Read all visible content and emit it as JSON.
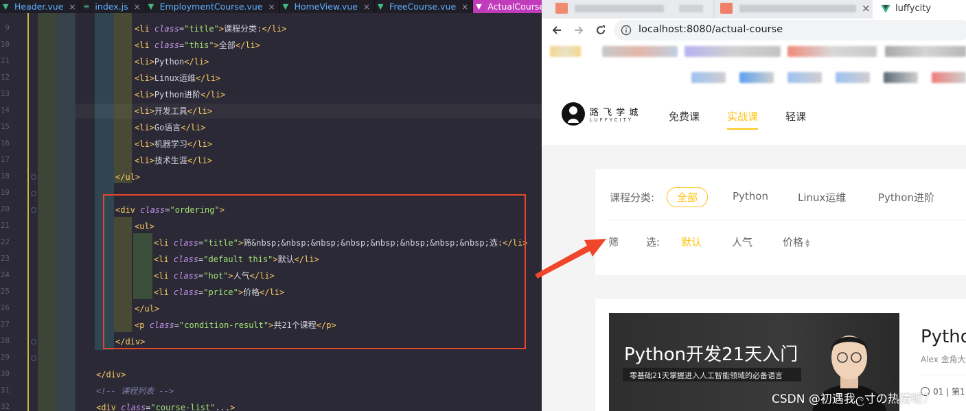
{
  "editor": {
    "tabs": [
      {
        "label": "Header.vue",
        "icon": "vue-icon",
        "active": false
      },
      {
        "label": "index.js",
        "icon": "js-file-icon",
        "active": false
      },
      {
        "label": "EmploymentCourse.vue",
        "icon": "vue-icon",
        "active": false
      },
      {
        "label": "HomeView.vue",
        "icon": "vue-icon",
        "active": false
      },
      {
        "label": "FreeCourse.vue",
        "icon": "vue-icon",
        "active": false
      },
      {
        "label": "ActualCourse.vue",
        "icon": "vue-icon",
        "active": true
      }
    ],
    "close_glyph": "×",
    "line_numbers": [
      "9",
      "10",
      "11",
      "12",
      "13",
      "14",
      "15",
      "16",
      "17",
      "18",
      "19",
      "20",
      "21",
      "22",
      "23",
      "24",
      "25",
      "26",
      "27",
      "28",
      "29",
      "30",
      "31",
      "32"
    ],
    "code_lines": [
      {
        "indent": 196,
        "parts": [
          [
            "tg",
            "<li "
          ],
          [
            "at",
            "class"
          ],
          [
            "tx",
            "="
          ],
          [
            "st",
            "\"title\""
          ],
          [
            "tg",
            ">"
          ],
          [
            "tx",
            "课程分类:"
          ],
          [
            "tg",
            "</li>"
          ]
        ]
      },
      {
        "indent": 196,
        "parts": [
          [
            "tg",
            "<li "
          ],
          [
            "at",
            "class"
          ],
          [
            "tx",
            "="
          ],
          [
            "st",
            "\"this\""
          ],
          [
            "tg",
            ">"
          ],
          [
            "tx",
            "全部"
          ],
          [
            "tg",
            "</li>"
          ]
        ]
      },
      {
        "indent": 196,
        "parts": [
          [
            "tg",
            "<li>"
          ],
          [
            "tx",
            "Python"
          ],
          [
            "tg",
            "</li>"
          ]
        ]
      },
      {
        "indent": 196,
        "parts": [
          [
            "tg",
            "<li>"
          ],
          [
            "tx",
            "Linux运维"
          ],
          [
            "tg",
            "</li>"
          ]
        ]
      },
      {
        "indent": 196,
        "parts": [
          [
            "tg",
            "<li>"
          ],
          [
            "tx",
            "Python进阶"
          ],
          [
            "tg",
            "</li>"
          ]
        ]
      },
      {
        "indent": 196,
        "parts": [
          [
            "tg",
            "<li>"
          ],
          [
            "tx",
            "开发工具"
          ],
          [
            "tg",
            "</li>"
          ]
        ]
      },
      {
        "indent": 196,
        "parts": [
          [
            "tg",
            "<li>"
          ],
          [
            "tx",
            "Go语言"
          ],
          [
            "tg",
            "</li>"
          ]
        ]
      },
      {
        "indent": 196,
        "parts": [
          [
            "tg",
            "<li>"
          ],
          [
            "tx",
            "机器学习"
          ],
          [
            "tg",
            "</li>"
          ]
        ]
      },
      {
        "indent": 196,
        "parts": [
          [
            "tg",
            "<li>"
          ],
          [
            "tx",
            "技术生涯"
          ],
          [
            "tg",
            "</li>"
          ]
        ]
      },
      {
        "indent": 168,
        "parts": [
          [
            "tg",
            "</ul>"
          ]
        ]
      },
      {
        "indent": 168,
        "parts": []
      },
      {
        "indent": 168,
        "parts": [
          [
            "tg",
            "<div "
          ],
          [
            "at",
            "class"
          ],
          [
            "tx",
            "="
          ],
          [
            "st",
            "\"ordering\""
          ],
          [
            "tg",
            ">"
          ]
        ]
      },
      {
        "indent": 196,
        "parts": [
          [
            "tg",
            "<ul>"
          ]
        ]
      },
      {
        "indent": 224,
        "parts": [
          [
            "tg",
            "<li "
          ],
          [
            "at",
            "class"
          ],
          [
            "tx",
            "="
          ],
          [
            "st",
            "\"title\""
          ],
          [
            "tg",
            ">"
          ],
          [
            "tx",
            "筛&nbsp;&nbsp;&nbsp;&nbsp;&nbsp;&nbsp;&nbsp;&nbsp;选:"
          ],
          [
            "tg",
            "</li>"
          ]
        ]
      },
      {
        "indent": 224,
        "parts": [
          [
            "tg",
            "<li "
          ],
          [
            "at",
            "class"
          ],
          [
            "tx",
            "="
          ],
          [
            "st",
            "\"default this\""
          ],
          [
            "tg",
            ">"
          ],
          [
            "tx",
            "默认"
          ],
          [
            "tg",
            "</li>"
          ]
        ]
      },
      {
        "indent": 224,
        "parts": [
          [
            "tg",
            "<li "
          ],
          [
            "at",
            "class"
          ],
          [
            "tx",
            "="
          ],
          [
            "st",
            "\"hot\""
          ],
          [
            "tg",
            ">"
          ],
          [
            "tx",
            "人气"
          ],
          [
            "tg",
            "</li>"
          ]
        ]
      },
      {
        "indent": 224,
        "parts": [
          [
            "tg",
            "<li "
          ],
          [
            "at",
            "class"
          ],
          [
            "tx",
            "="
          ],
          [
            "st",
            "\"price\""
          ],
          [
            "tg",
            ">"
          ],
          [
            "tx",
            "价格"
          ],
          [
            "tg",
            "</li>"
          ]
        ]
      },
      {
        "indent": 196,
        "parts": [
          [
            "tg",
            "</ul>"
          ]
        ]
      },
      {
        "indent": 196,
        "parts": [
          [
            "tg",
            "<p "
          ],
          [
            "at",
            "class"
          ],
          [
            "tx",
            "="
          ],
          [
            "st",
            "\"condition-result\""
          ],
          [
            "tg",
            ">"
          ],
          [
            "tx",
            "共21个课程"
          ],
          [
            "tg",
            "</p>"
          ]
        ]
      },
      {
        "indent": 168,
        "parts": [
          [
            "tg",
            "</div>"
          ]
        ]
      },
      {
        "indent": 140,
        "parts": []
      },
      {
        "indent": 140,
        "parts": [
          [
            "tg",
            "</div>"
          ]
        ]
      },
      {
        "indent": 140,
        "parts": [
          [
            "cm",
            "<!-- 课程列表 -->"
          ]
        ]
      },
      {
        "indent": 140,
        "parts": [
          [
            "tg",
            "<div "
          ],
          [
            "at",
            "class"
          ],
          [
            "tx",
            "="
          ],
          [
            "st",
            "\"course-list\""
          ],
          [
            "tx",
            "..."
          ],
          [
            "tg",
            ">"
          ]
        ]
      }
    ]
  },
  "browser": {
    "tab_title": "luffycity",
    "tab_close": "×",
    "url": "localhost:8080/actual-course",
    "back_icon": "back-arrow-icon",
    "forward_icon": "forward-arrow-icon",
    "reload_icon": "reload-icon",
    "info_icon": "info-icon"
  },
  "site": {
    "logo_cn": "路 飞 学 城",
    "logo_en": "LUFFYCITY",
    "nav": [
      {
        "label": "免费课",
        "active": false
      },
      {
        "label": "实战课",
        "active": true
      },
      {
        "label": "轻课",
        "active": false
      }
    ],
    "category_title": "课程分类:",
    "categories": [
      {
        "label": "全部",
        "active": true
      },
      {
        "label": "Python",
        "active": false
      },
      {
        "label": "Linux运维",
        "active": false
      },
      {
        "label": "Python进阶",
        "active": false
      }
    ],
    "filter_title_1": "筛",
    "filter_title_2": "选:",
    "filters": [
      {
        "label": "默认",
        "active": true
      },
      {
        "label": "人气",
        "active": false
      },
      {
        "label": "价格",
        "active": false
      }
    ],
    "course": {
      "banner_title": "Python开发21天入门",
      "banner_subtitle": "零基础21天掌握进入人工智能领域的必备语言",
      "title_partial": "Pytho",
      "teacher_partial": "Alex 金角大",
      "lesson_partial": "01 | 第1"
    }
  },
  "watermark": "CSDN @初遇我ල寸の热情呢？",
  "colors": {
    "accent": "#ffc210",
    "red_box": "#e8452c",
    "arrow": "#f0462a",
    "active_tab": "#c13bbd"
  }
}
